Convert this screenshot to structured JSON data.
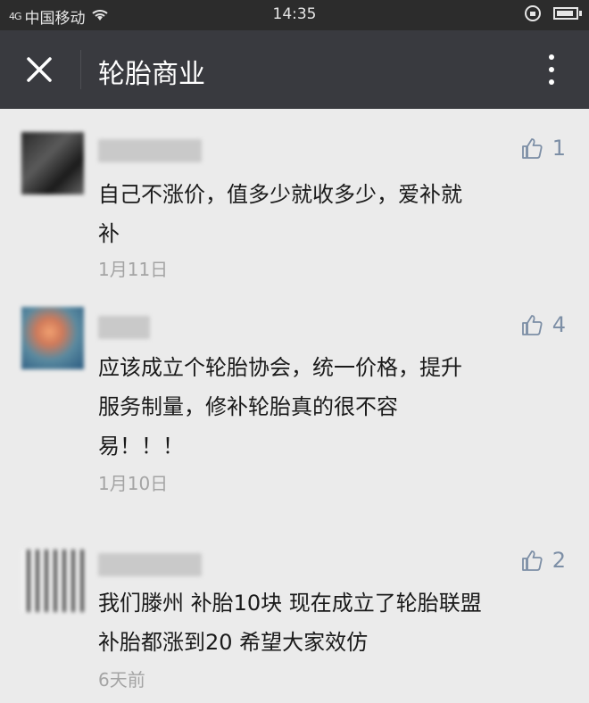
{
  "status_bar": {
    "carrier": "中国移动",
    "signal": "4G",
    "time": "14:35"
  },
  "nav": {
    "title": "轮胎商业"
  },
  "comments": [
    {
      "text": "自己不涨价，值多少就收多少，爱补就\n补",
      "likes": "1",
      "date": "1月11日"
    },
    {
      "text": "应该成立个轮胎协会，统一价格，提升\n服务制量，修补轮胎真的很不容\n易！！！",
      "likes": "4",
      "date": "1月10日"
    },
    {
      "text": "我们滕州 补胎10块 现在成立了轮胎联盟\n补胎都涨到20 希望大家效仿",
      "likes": "2",
      "date": "6天前"
    }
  ],
  "icons": {
    "close": "close-icon",
    "more": "more-vertical-icon",
    "like": "thumbs-up-icon",
    "wifi": "wifi-icon",
    "lock": "rotation-lock-icon",
    "battery": "battery-icon"
  },
  "colors": {
    "nav_bg": "#393a3f",
    "status_bg": "#2c2c2c",
    "page_bg": "#ebebeb",
    "like_color": "#7d8fa6",
    "date_color": "#a4a4a4"
  }
}
